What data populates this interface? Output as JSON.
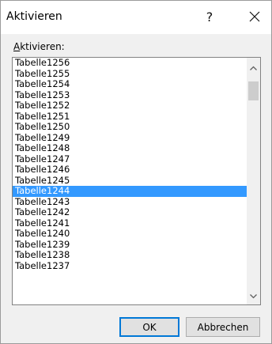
{
  "dialog": {
    "title": "Aktivieren",
    "help_glyph": "?",
    "list_label": "Aktivieren:",
    "items": [
      "Tabelle1256",
      "Tabelle1255",
      "Tabelle1254",
      "Tabelle1253",
      "Tabelle1252",
      "Tabelle1251",
      "Tabelle1250",
      "Tabelle1249",
      "Tabelle1248",
      "Tabelle1247",
      "Tabelle1246",
      "Tabelle1245",
      "Tabelle1244",
      "Tabelle1243",
      "Tabelle1242",
      "Tabelle1241",
      "Tabelle1240",
      "Tabelle1239",
      "Tabelle1238",
      "Tabelle1237"
    ],
    "selected_item": "Tabelle1244",
    "ok_label": "OK",
    "cancel_label": "Abbrechen"
  },
  "colors": {
    "selection": "#3399ff",
    "default_button_border": "#0078d7"
  }
}
